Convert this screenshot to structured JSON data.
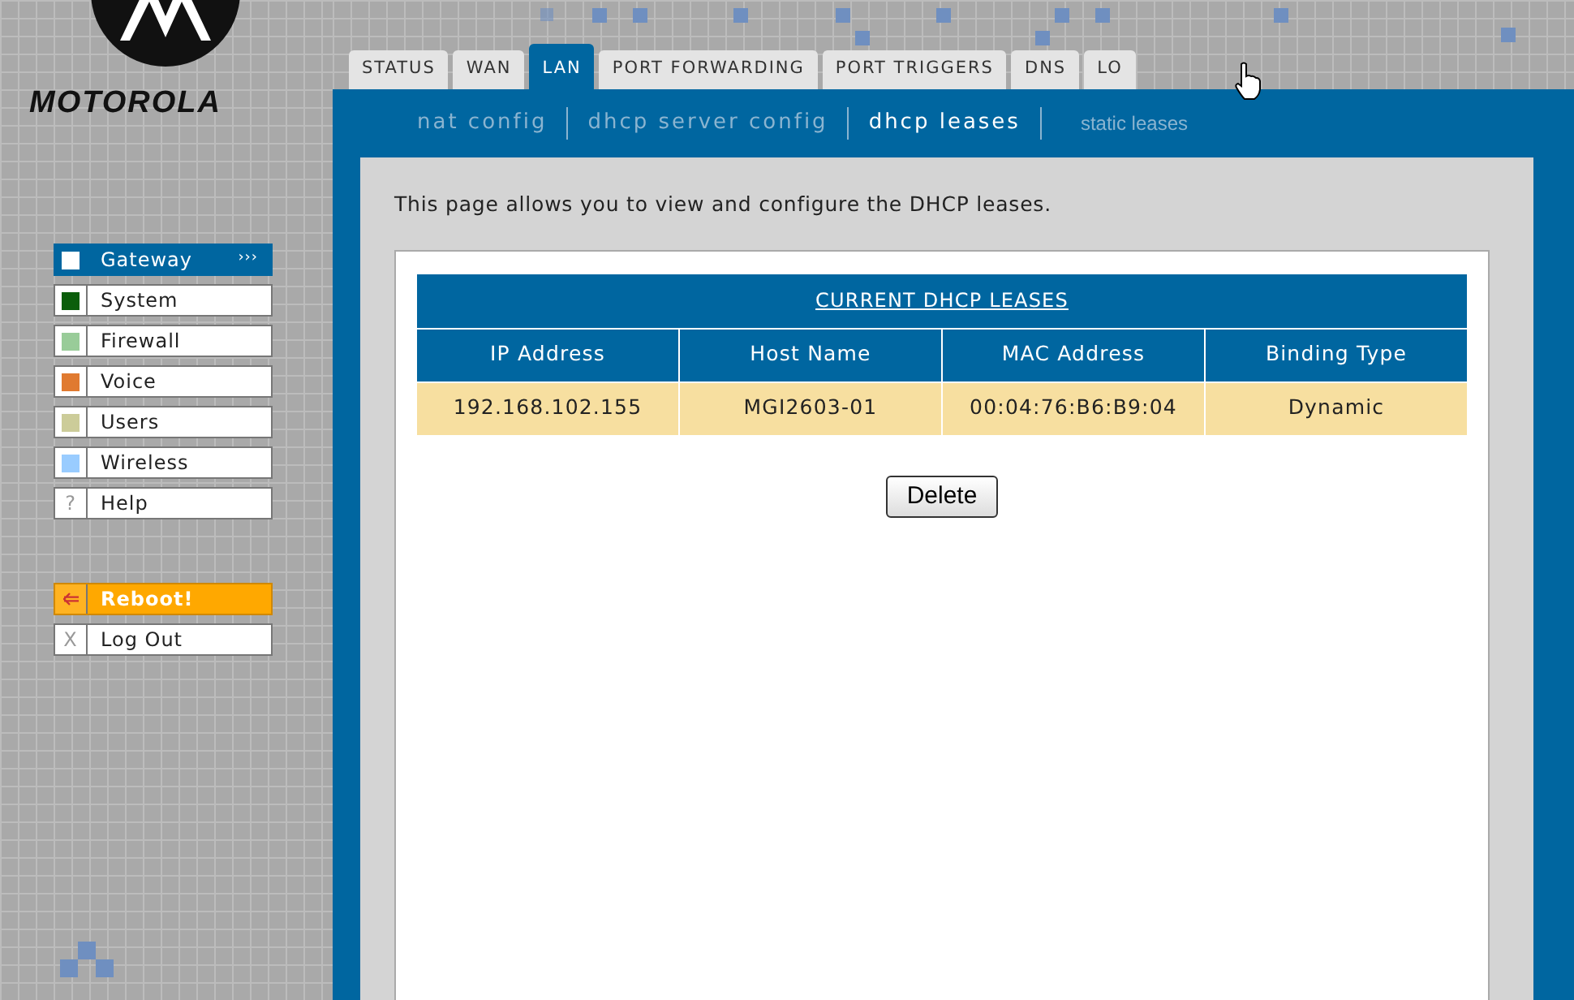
{
  "brand": {
    "name": "MOTOROLA"
  },
  "tabs": [
    {
      "label": "STATUS",
      "selected": false
    },
    {
      "label": "WAN",
      "selected": false
    },
    {
      "label": "LAN",
      "selected": true
    },
    {
      "label": "PORT FORWARDING",
      "selected": false
    },
    {
      "label": "PORT TRIGGERS",
      "selected": false
    },
    {
      "label": "DNS",
      "selected": false
    },
    {
      "label": "LO",
      "selected": false
    }
  ],
  "subnav": [
    {
      "label": "nat config",
      "selected": false
    },
    {
      "label": "dhcp server config",
      "selected": false
    },
    {
      "label": "dhcp leases",
      "selected": true
    },
    {
      "label": "static leases",
      "selected": false
    }
  ],
  "sidebar": {
    "items": [
      {
        "kind": "section",
        "label": "Gateway",
        "color": "#ffffff",
        "selected": true,
        "more": "›››"
      },
      {
        "kind": "section",
        "label": "System",
        "color": "#0b5e0b",
        "selected": false
      },
      {
        "kind": "section",
        "label": "Firewall",
        "color": "#99cc99",
        "selected": false
      },
      {
        "kind": "section",
        "label": "Voice",
        "color": "#e07a30",
        "selected": false
      },
      {
        "kind": "section",
        "label": "Users",
        "color": "#cccc99",
        "selected": false
      },
      {
        "kind": "section",
        "label": "Wireless",
        "color": "#99ccff",
        "selected": false
      },
      {
        "kind": "glyph",
        "label": "Help",
        "glyph": "?",
        "selected": false
      }
    ],
    "actions": [
      {
        "kind": "reboot",
        "label": "Reboot!"
      },
      {
        "kind": "glyph",
        "label": "Log Out",
        "glyph": "X"
      }
    ]
  },
  "intro": "This page allows you to view and configure the DHCP leases.",
  "table": {
    "title": "CURRENT DHCP LEASES",
    "columns": [
      "IP Address",
      "Host Name",
      "MAC Address",
      "Binding Type"
    ],
    "rows": [
      [
        "192.168.102.155",
        "MGI2603-01",
        "00:04:76:B6:B9:04",
        "Dynamic"
      ]
    ]
  },
  "buttons": [
    "Delete"
  ]
}
